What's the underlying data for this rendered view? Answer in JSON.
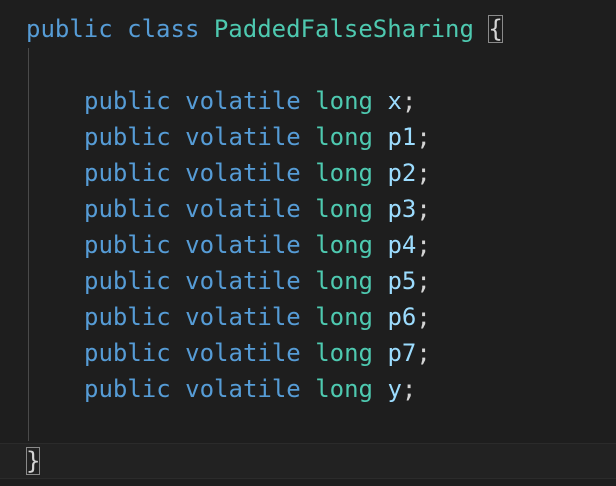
{
  "code": {
    "class_header": {
      "modifier": "public",
      "keyword": "class",
      "class_name": "PaddedFalseSharing",
      "open_brace": "{"
    },
    "fields": [
      {
        "modifier": "public",
        "qualifier": "volatile",
        "type": "long",
        "name": "x",
        "terminator": ";"
      },
      {
        "modifier": "public",
        "qualifier": "volatile",
        "type": "long",
        "name": "p1",
        "terminator": ";"
      },
      {
        "modifier": "public",
        "qualifier": "volatile",
        "type": "long",
        "name": "p2",
        "terminator": ";"
      },
      {
        "modifier": "public",
        "qualifier": "volatile",
        "type": "long",
        "name": "p3",
        "terminator": ";"
      },
      {
        "modifier": "public",
        "qualifier": "volatile",
        "type": "long",
        "name": "p4",
        "terminator": ";"
      },
      {
        "modifier": "public",
        "qualifier": "volatile",
        "type": "long",
        "name": "p5",
        "terminator": ";"
      },
      {
        "modifier": "public",
        "qualifier": "volatile",
        "type": "long",
        "name": "p6",
        "terminator": ";"
      },
      {
        "modifier": "public",
        "qualifier": "volatile",
        "type": "long",
        "name": "p7",
        "terminator": ";"
      },
      {
        "modifier": "public",
        "qualifier": "volatile",
        "type": "long",
        "name": "y",
        "terminator": ";"
      }
    ],
    "close_brace": "}"
  },
  "theme": {
    "background": "#1e1e1e",
    "keyword": "#569cd6",
    "type": "#4ec9b0",
    "variable": "#9cdcfe",
    "punctuation": "#d4d4d4"
  }
}
